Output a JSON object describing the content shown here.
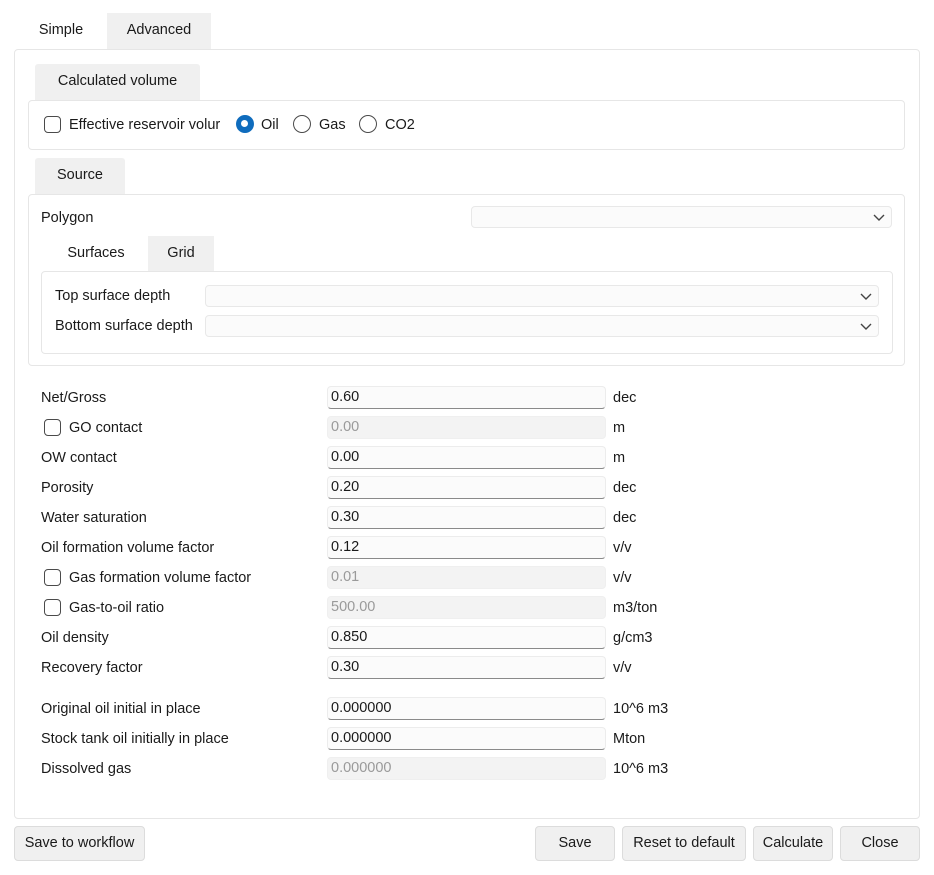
{
  "tabs": {
    "simple": "Simple",
    "advanced": "Advanced"
  },
  "calculated_volume": {
    "title": "Calculated volume",
    "options": {
      "effective": "Effective reservoir volur",
      "oil": "Oil",
      "gas": "Gas",
      "co2": "CO2"
    },
    "selected": "Oil"
  },
  "source": {
    "title": "Source",
    "polygon_label": "Polygon",
    "polygon_value": "",
    "subtabs": {
      "surfaces": "Surfaces",
      "grid": "Grid"
    },
    "top_label": "Top surface depth",
    "top_value": "",
    "bottom_label": "Bottom surface depth",
    "bottom_value": ""
  },
  "params": {
    "net_gross": {
      "label": "Net/Gross",
      "value": "0.60",
      "unit": "dec"
    },
    "go_contact": {
      "label": "GO contact",
      "value": "0.00",
      "unit": "m",
      "checked": false
    },
    "ow_contact": {
      "label": "OW contact",
      "value": "0.00",
      "unit": "m"
    },
    "porosity": {
      "label": "Porosity",
      "value": "0.20",
      "unit": "dec"
    },
    "water_sat": {
      "label": "Water saturation",
      "value": "0.30",
      "unit": "dec"
    },
    "oil_fvf": {
      "label": "Oil formation volume factor",
      "value": "0.12",
      "unit": "v/v"
    },
    "gas_fvf": {
      "label": "Gas formation volume factor",
      "value": "0.01",
      "unit": "v/v",
      "checked": false
    },
    "gor": {
      "label": "Gas-to-oil ratio",
      "value": "500.00",
      "unit": "m3/ton",
      "checked": false
    },
    "oil_density": {
      "label": "Oil density",
      "value": "0.850",
      "unit": "g/cm3"
    },
    "recovery": {
      "label": "Recovery factor",
      "value": "0.30",
      "unit": "v/v"
    }
  },
  "results": {
    "ooip": {
      "label": "Original oil initial in place",
      "value": "0.000000",
      "unit": "10^6 m3"
    },
    "stoiip": {
      "label": "Stock tank oil initially in place",
      "value": "0.000000",
      "unit": "Mton"
    },
    "dissolved_gas": {
      "label": "Dissolved gas",
      "value": "0.000000",
      "unit": "10^6 m3"
    }
  },
  "buttons": {
    "save_workflow": "Save to workflow",
    "save": "Save",
    "reset": "Reset to default",
    "calculate": "Calculate",
    "close": "Close"
  },
  "colors": {
    "accent": "#0f6cbd",
    "tab_bg": "#f0f0f0",
    "border": "#e6e6e6"
  }
}
